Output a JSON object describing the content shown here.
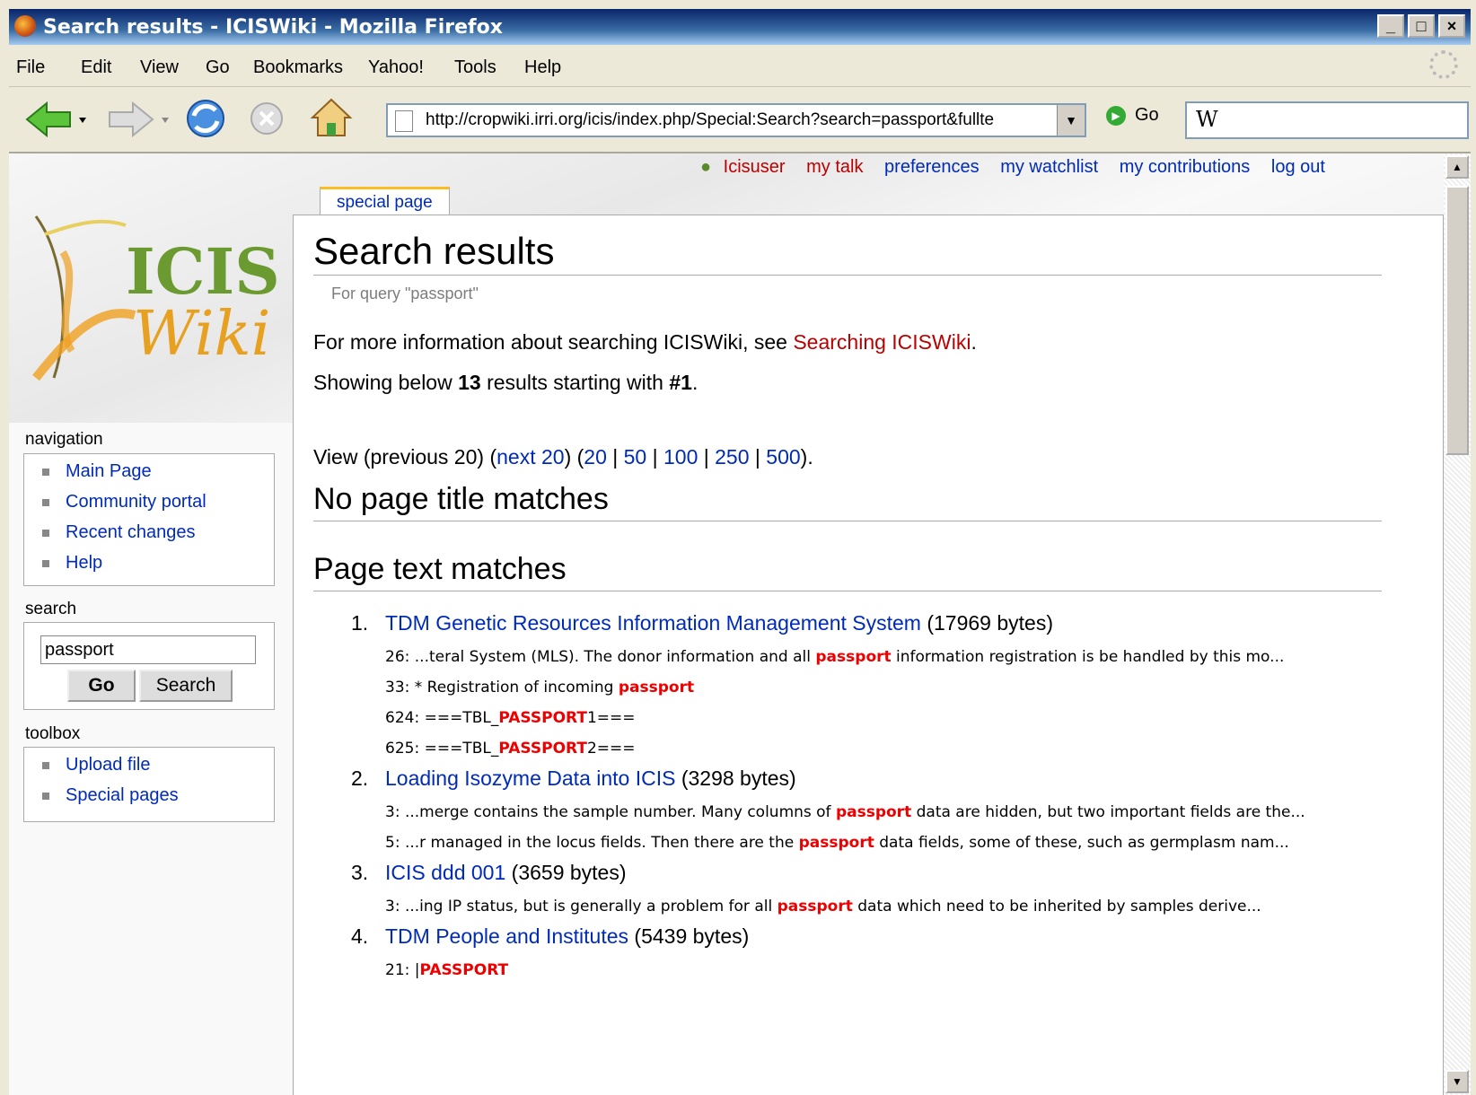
{
  "window": {
    "title": "Search results - ICISWiki - Mozilla Firefox"
  },
  "menu": [
    "File",
    "Edit",
    "View",
    "Go",
    "Bookmarks",
    "Yahoo!",
    "Tools",
    "Help"
  ],
  "toolbar": {
    "url": "http://cropwiki.irri.org/icis/index.php/Special:Search?search=passport&fullte",
    "go_label": "Go",
    "search_engine_glyph": "W"
  },
  "personal": {
    "user": "Icisuser",
    "my_talk": "my talk",
    "preferences": "preferences",
    "my_watchlist": "my watchlist",
    "my_contributions": "my contributions",
    "log_out": "log out"
  },
  "tab": {
    "label": "special page"
  },
  "sidebar": {
    "logo": {
      "line1": "ICIS",
      "line2": "Wiki"
    },
    "navigation": {
      "heading": "navigation",
      "items": [
        "Main Page",
        "Community portal",
        "Recent changes",
        "Help"
      ]
    },
    "search": {
      "heading": "search",
      "value": "passport",
      "go": "Go",
      "search": "Search"
    },
    "toolbox": {
      "heading": "toolbox",
      "items": [
        "Upload file",
        "Special pages"
      ]
    }
  },
  "page": {
    "title": "Search results",
    "subtitle": "For query \"passport\"",
    "info_text": "For more information about searching ICISWiki, see",
    "info_link": "Searching ICISWiki",
    "showing_pre": "Showing below",
    "showing_count": "13",
    "showing_mid": "results starting with",
    "showing_start": "#1",
    "view_pre": "View (previous 20) (",
    "view_next": "next 20",
    "view_counts": [
      "20",
      "50",
      "100",
      "250",
      "500"
    ],
    "no_title_heading": "No page title matches",
    "text_heading": "Page text matches"
  },
  "results": [
    {
      "num": "1.",
      "title": "TDM Genetic Resources Information Management System",
      "size": "(17969 bytes)",
      "snippets": [
        {
          "pre": "26: ...teral System (MLS). The donor information and all ",
          "hl": "passport",
          "post": " information registration is be handled by this mo..."
        },
        {
          "pre": "33: * Registration of incoming ",
          "hl": "passport",
          "post": ""
        },
        {
          "pre": "624: ===TBL_",
          "hl": "PASSPORT",
          "post": "1==="
        },
        {
          "pre": "625: ===TBL_",
          "hl": "PASSPORT",
          "post": "2==="
        }
      ]
    },
    {
      "num": "2.",
      "title": "Loading Isozyme Data into ICIS",
      "size": "(3298 bytes)",
      "snippets": [
        {
          "pre": "3: ...merge contains the sample number. Many columns of ",
          "hl": "passport",
          "post": " data are hidden, but two important fields are the..."
        },
        {
          "pre": "5: ...r managed in the locus fields. Then there are the ",
          "hl": "passport",
          "post": " data fields, some of these, such as germplasm nam..."
        }
      ]
    },
    {
      "num": "3.",
      "title": "ICIS ddd 001",
      "size": "(3659 bytes)",
      "snippets": [
        {
          "pre": "3: ...ing IP status, but is generally a problem for all ",
          "hl": "passport",
          "post": " data which need to be inherited by samples derive..."
        }
      ]
    },
    {
      "num": "4.",
      "title": "TDM People and Institutes",
      "size": "(5439 bytes)",
      "snippets": [
        {
          "pre": "21: |",
          "hl": "PASSPORT",
          "post": ""
        }
      ]
    }
  ]
}
